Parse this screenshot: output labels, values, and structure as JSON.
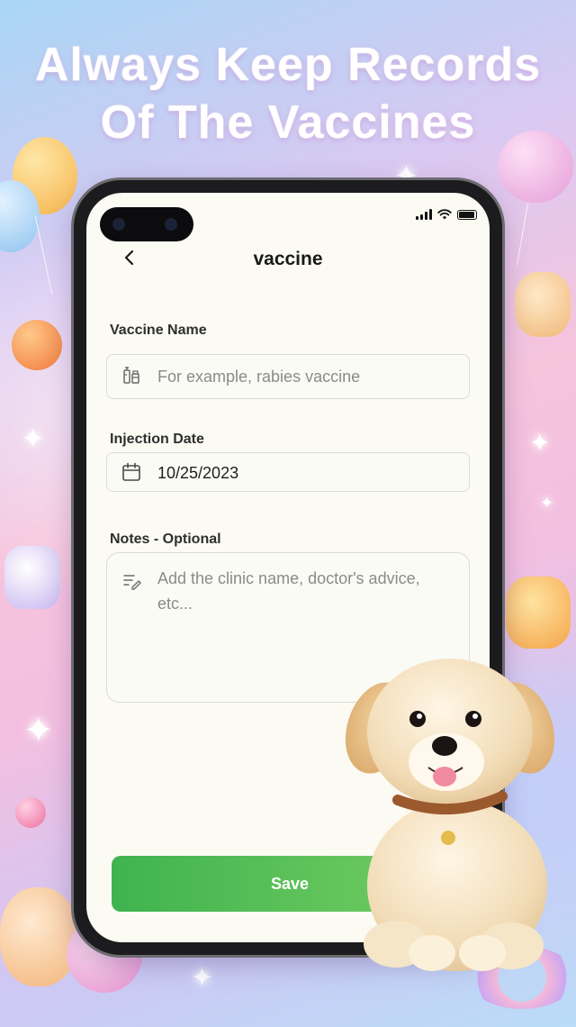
{
  "promo": {
    "headline_line1": "Always Keep Records",
    "headline_line2": "Of The Vaccines"
  },
  "status_bar": {
    "signal_icon": "cellular-signal-icon",
    "wifi_icon": "wifi-icon",
    "battery_icon": "battery-icon"
  },
  "header": {
    "back_icon": "chevron-left-icon",
    "title": "vaccine"
  },
  "form": {
    "vaccine_name": {
      "label": "Vaccine Name",
      "icon": "syringe-vial-icon",
      "placeholder": "For example, rabies vaccine",
      "value": ""
    },
    "injection_date": {
      "label": "Injection Date",
      "icon": "calendar-icon",
      "value": "10/25/2023"
    },
    "notes": {
      "label": "Notes - Optional",
      "icon": "notes-edit-icon",
      "placeholder_line1": "Add the clinic name, doctor's advice,",
      "placeholder_line2": "etc..."
    },
    "save_label": "Save"
  },
  "colors": {
    "save_button": "#4cbc55",
    "screen_bg": "#fbfaf3",
    "headline": "#ffffff"
  }
}
